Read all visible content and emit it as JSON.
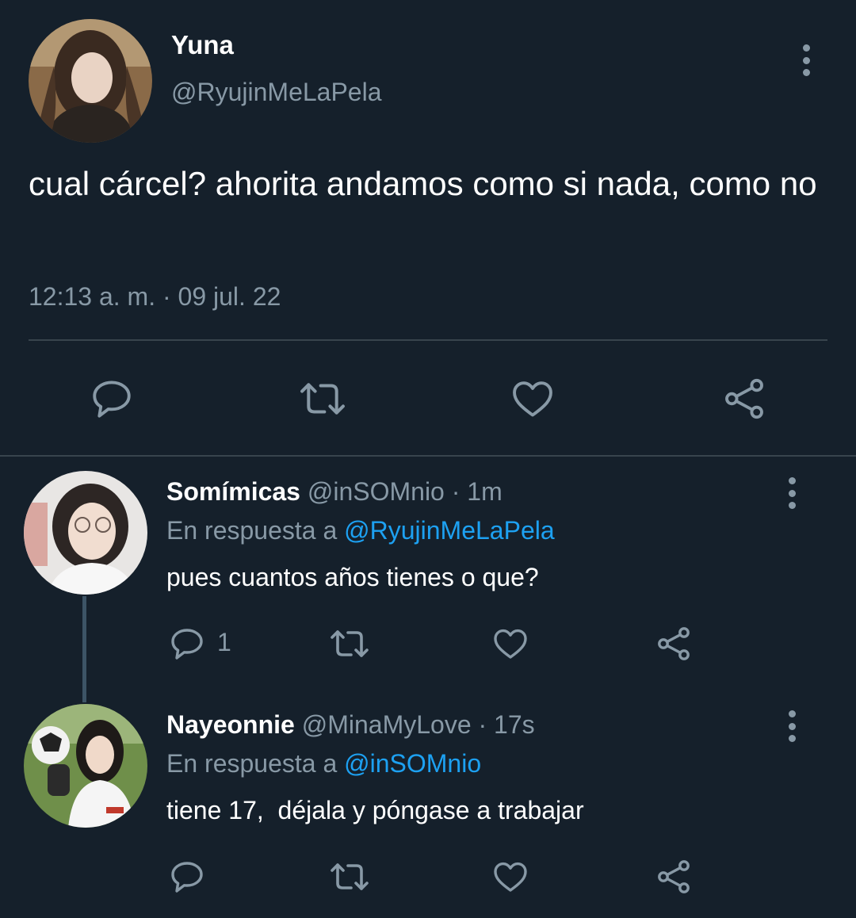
{
  "main_tweet": {
    "author_name": "Yuna",
    "author_handle": "@RyujinMeLaPela",
    "text": "cual cárcel? ahorita andamos como si nada, como no",
    "timestamp": "12:13 a. m. · 09 jul. 22",
    "actions": [
      "reply-icon",
      "retweet-icon",
      "like-icon",
      "share-icon"
    ]
  },
  "replies": [
    {
      "author_name": "Somímicas",
      "meta": "@inSOMnio · 1m",
      "reply_prefix": "En respuesta a ",
      "reply_to": "@RyujinMeLaPela",
      "text": "pues cuantos años tienes o que?",
      "reply_count": "1"
    },
    {
      "author_name": "Nayeonnie",
      "meta": "@MinaMyLove · 17s",
      "reply_prefix": "En respuesta a ",
      "reply_to": "@inSOMnio",
      "text": "tiene 17,  déjala y póngase a trabajar",
      "reply_count": ""
    }
  ],
  "colors": {
    "background": "#15202b",
    "secondary_text": "#8899a6",
    "link": "#1da1f2",
    "divider": "#38444d"
  }
}
